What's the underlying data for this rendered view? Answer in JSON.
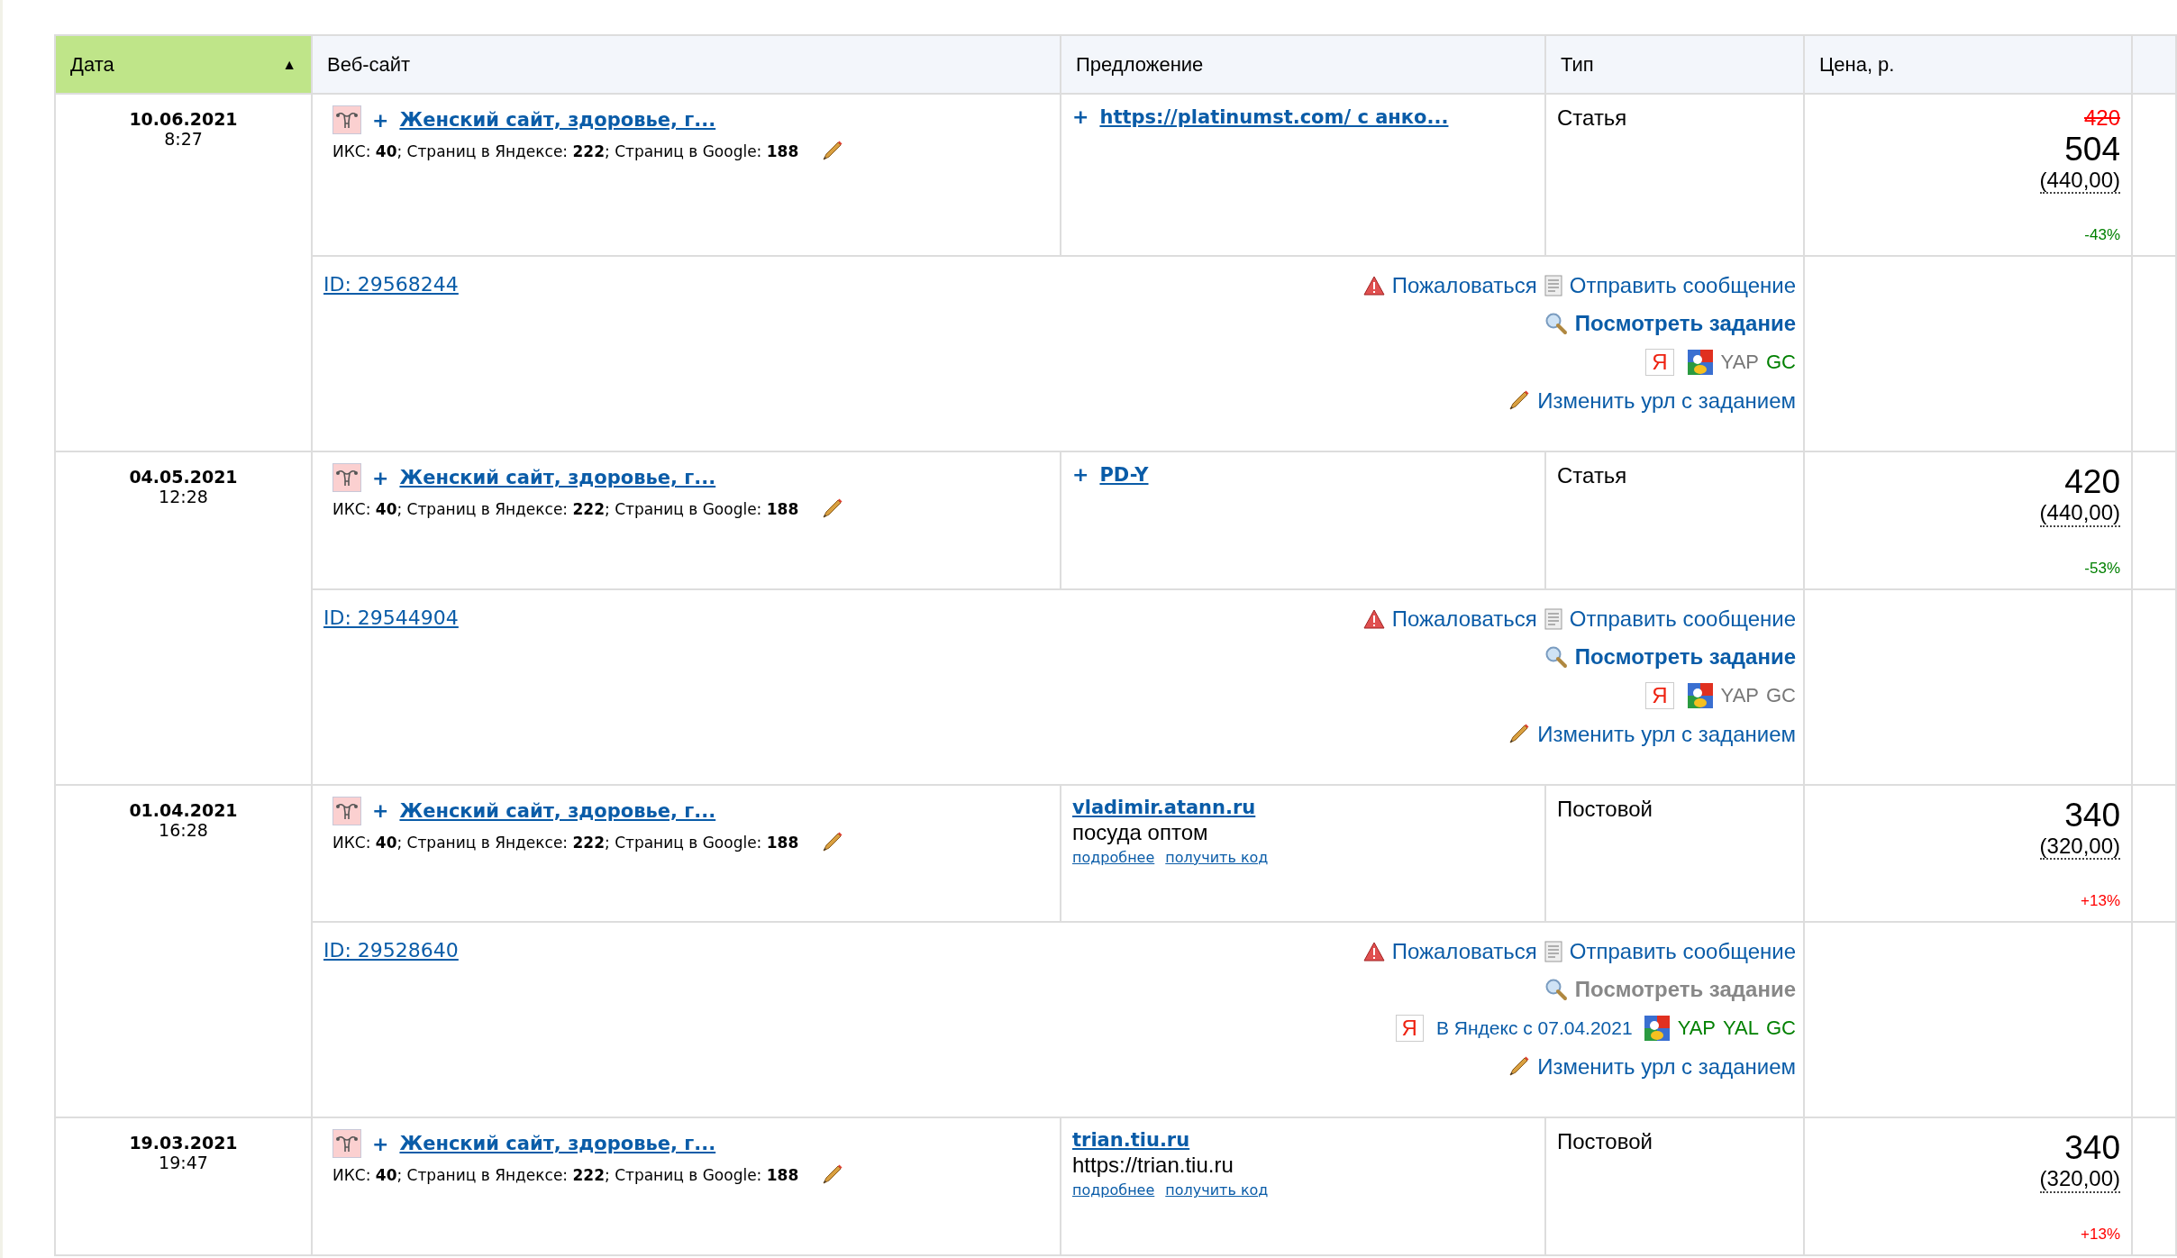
{
  "columns": [
    {
      "label": "Дата",
      "sorted": true,
      "sort_arrow": "▲"
    },
    {
      "label": "Веб-сайт",
      "sorted": false
    },
    {
      "label": "Предложение",
      "sorted": false
    },
    {
      "label": "Тип",
      "sorted": false
    },
    {
      "label": "Цена, р.",
      "sorted": false
    }
  ],
  "rows": [
    {
      "date": "10.06.2021",
      "time": "8:27",
      "site": {
        "expander": "+",
        "name": "Женский сайт, здоровье, г...",
        "stats": "ИКС: **40**; Страниц в Яндексе: **222**; Страниц в Google: **188**"
      },
      "offer": {
        "expander": "+",
        "link": "https://platinumst.com/ с анко..."
      },
      "type": "Статья",
      "price": {
        "old": "420",
        "current": "504",
        "base": "(440,00)",
        "change": "-43%",
        "color": "#008000"
      },
      "details": {
        "id": "ID: 29568244",
        "complain": "Пожаловаться",
        "message": "Отправить сообщение",
        "view_task": "Посмотреть задание",
        "view_task_active": true,
        "yandex_badge": "Я",
        "codes": [
          {
            "text": "YAP",
            "color": "#777777"
          },
          {
            "text": "GC",
            "color": "#008000"
          }
        ],
        "edit_url": "Изменить урл с заданием"
      }
    },
    {
      "date": "04.05.2021",
      "time": "12:28",
      "site": {
        "expander": "+",
        "name": "Женский сайт, здоровье, г...",
        "stats": "ИКС: **40**; Страниц в Яндексе: **222**; Страниц в Google: **188**"
      },
      "offer": {
        "expander": "+",
        "link": "PD-Y"
      },
      "type": "Статья",
      "price": {
        "current": "420",
        "base": "(440,00)",
        "change": "-53%",
        "color": "#008000"
      },
      "details": {
        "id": "ID: 29544904",
        "complain": "Пожаловаться",
        "message": "Отправить сообщение",
        "view_task": "Посмотреть задание",
        "view_task_active": true,
        "yandex_badge": "Я",
        "codes": [
          {
            "text": "YAP",
            "color": "#777777"
          },
          {
            "text": "GC",
            "color": "#777777"
          }
        ],
        "edit_url": "Изменить урл с заданием"
      }
    },
    {
      "date": "01.04.2021",
      "time": "16:28",
      "site": {
        "expander": "+",
        "name": "Женский сайт, здоровье, г...",
        "stats": "ИКС: **40**; Страниц в Яндексе: **222**; Страниц в Google: **188**"
      },
      "offer": {
        "link": "vladimir.atann.ru",
        "description": "посуда оптом",
        "more": "подробнее",
        "get_code": "получить код"
      },
      "type": "Постовой",
      "price": {
        "current": "340",
        "base": "(320,00)",
        "change": "+13%",
        "color": "#ff0000"
      },
      "details": {
        "id": "ID: 29528640",
        "complain": "Пожаловаться",
        "message": "Отправить сообщение",
        "view_task": "Посмотреть задание",
        "view_task_active": false,
        "yandex_badge": "Я",
        "yandex_text": "В Яндекс с 07.04.2021",
        "codes": [
          {
            "text": "YAP",
            "color": "#008000"
          },
          {
            "text": "YAL",
            "color": "#008000"
          },
          {
            "text": "GC",
            "color": "#008000"
          }
        ],
        "edit_url": "Изменить урл с заданием"
      }
    },
    {
      "date": "19.03.2021",
      "time": "19:47",
      "site": {
        "expander": "+",
        "name": "Женский сайт, здоровье, г...",
        "stats": "ИКС: **40**; Страниц в Яндексе: **222**; Страниц в Google: **188**"
      },
      "offer": {
        "link": "trian.tiu.ru",
        "description": "https://trian.tiu.ru",
        "more": "подробнее",
        "get_code": "получить код"
      },
      "type": "Постовой",
      "price": {
        "current": "340",
        "base": "(320,00)",
        "change": "+13%",
        "color": "#ff0000"
      }
    }
  ]
}
